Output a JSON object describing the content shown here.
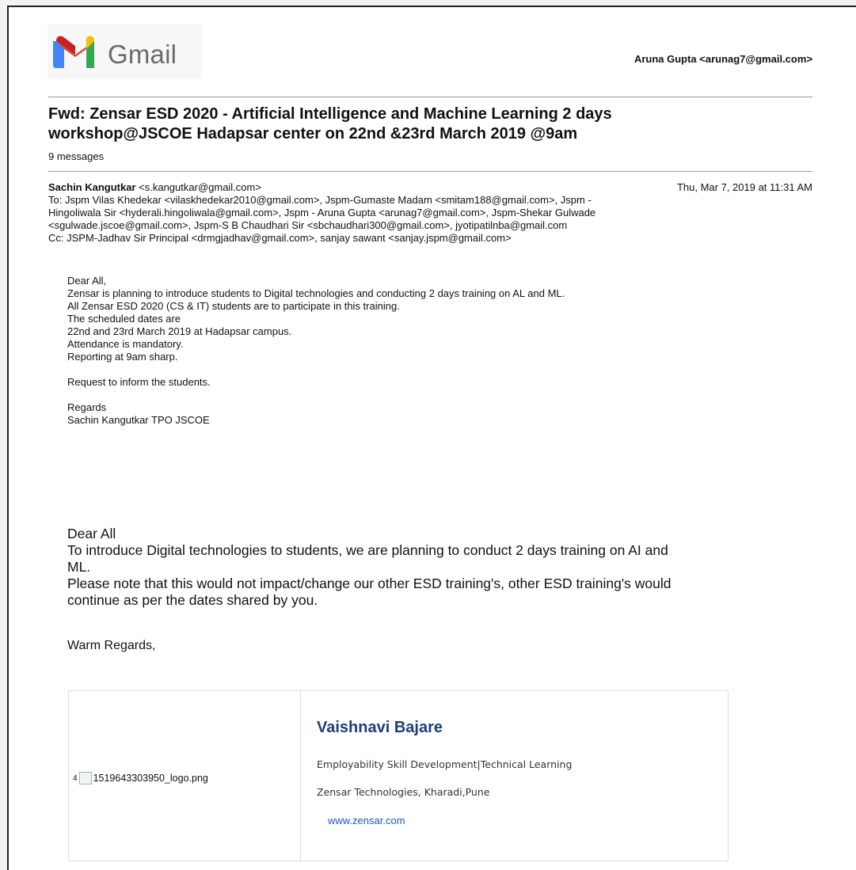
{
  "header": {
    "logo_text": "Gmail",
    "account": "Aruna Gupta <arunag7@gmail.com>"
  },
  "thread": {
    "subject_line1": "Fwd: Zensar ESD 2020 - Artificial Intelligence and Machine Learning 2 days",
    "subject_line2": "workshop@JSCOE Hadapsar center on 22nd &23rd March 2019 @9am",
    "message_count": "9 messages"
  },
  "message": {
    "sender_name": "Sachin Kangutkar",
    "sender_email": " <s.kangutkar@gmail.com>",
    "date": "Thu, Mar 7, 2019 at 11:31 AM",
    "to_line1": "To: Jspm Vilas Khedekar <vilaskhedekar2010@gmail.com>, Jspm-Gumaste Madam <smitam188@gmail.com>, Jspm -",
    "to_line2": "Hingoliwala Sir <hyderali.hingoliwala@gmail.com>, Jspm - Aruna Gupta <arunag7@gmail.com>, Jspm-Shekar Gulwade",
    "to_line3": "<sgulwade.jscoe@gmail.com>, Jspm-S B Chaudhari Sir <sbchaudhari300@gmail.com>, jyotipatilnba@gmail.com",
    "cc_line": "Cc: JSPM-Jadhav Sir Principal <drmgjadhav@gmail.com>, sanjay sawant <sanjay.jspm@gmail.com>"
  },
  "body1": {
    "l1": "Dear All,",
    "l2": "Zensar is planning to introduce students to Digital technologies and conducting 2 days training on AL and ML.",
    "l3": "All Zensar ESD 2020 (CS & IT) students are to participate in this training.",
    "l4": "The scheduled dates are",
    "l5": "22nd and 23rd March 2019 at Hadapsar campus.",
    "l6": "Attendance is mandatory.",
    "l7": "Reporting at 9am sharp.",
    "l8": "Request to inform the students.",
    "l9": "Regards",
    "l10": "Sachin Kangutkar TPO JSCOE"
  },
  "body2": {
    "l1": "Dear All",
    "l2": "To introduce Digital technologies to students, we are planning to conduct 2 days training on AI and",
    "l3": "ML.",
    "l4": "Please note that this would not impact/change our other ESD training's, other ESD training's would",
    "l5": "continue as per the dates shared by you.",
    "l6": "Warm Regards,"
  },
  "signature": {
    "image_prefix": "4",
    "image_alt": "1519643303950_logo.png",
    "name": "Vaishnavi Bajare",
    "role": "Employability Skill Development|Technical Learning",
    "company": "Zensar Technologies, Kharadi,Pune",
    "link": "www.zensar.com"
  },
  "colors": {
    "signature_name": "#1f3e7a",
    "link": "#1a56c8",
    "gmail_red": "#ea4335"
  }
}
